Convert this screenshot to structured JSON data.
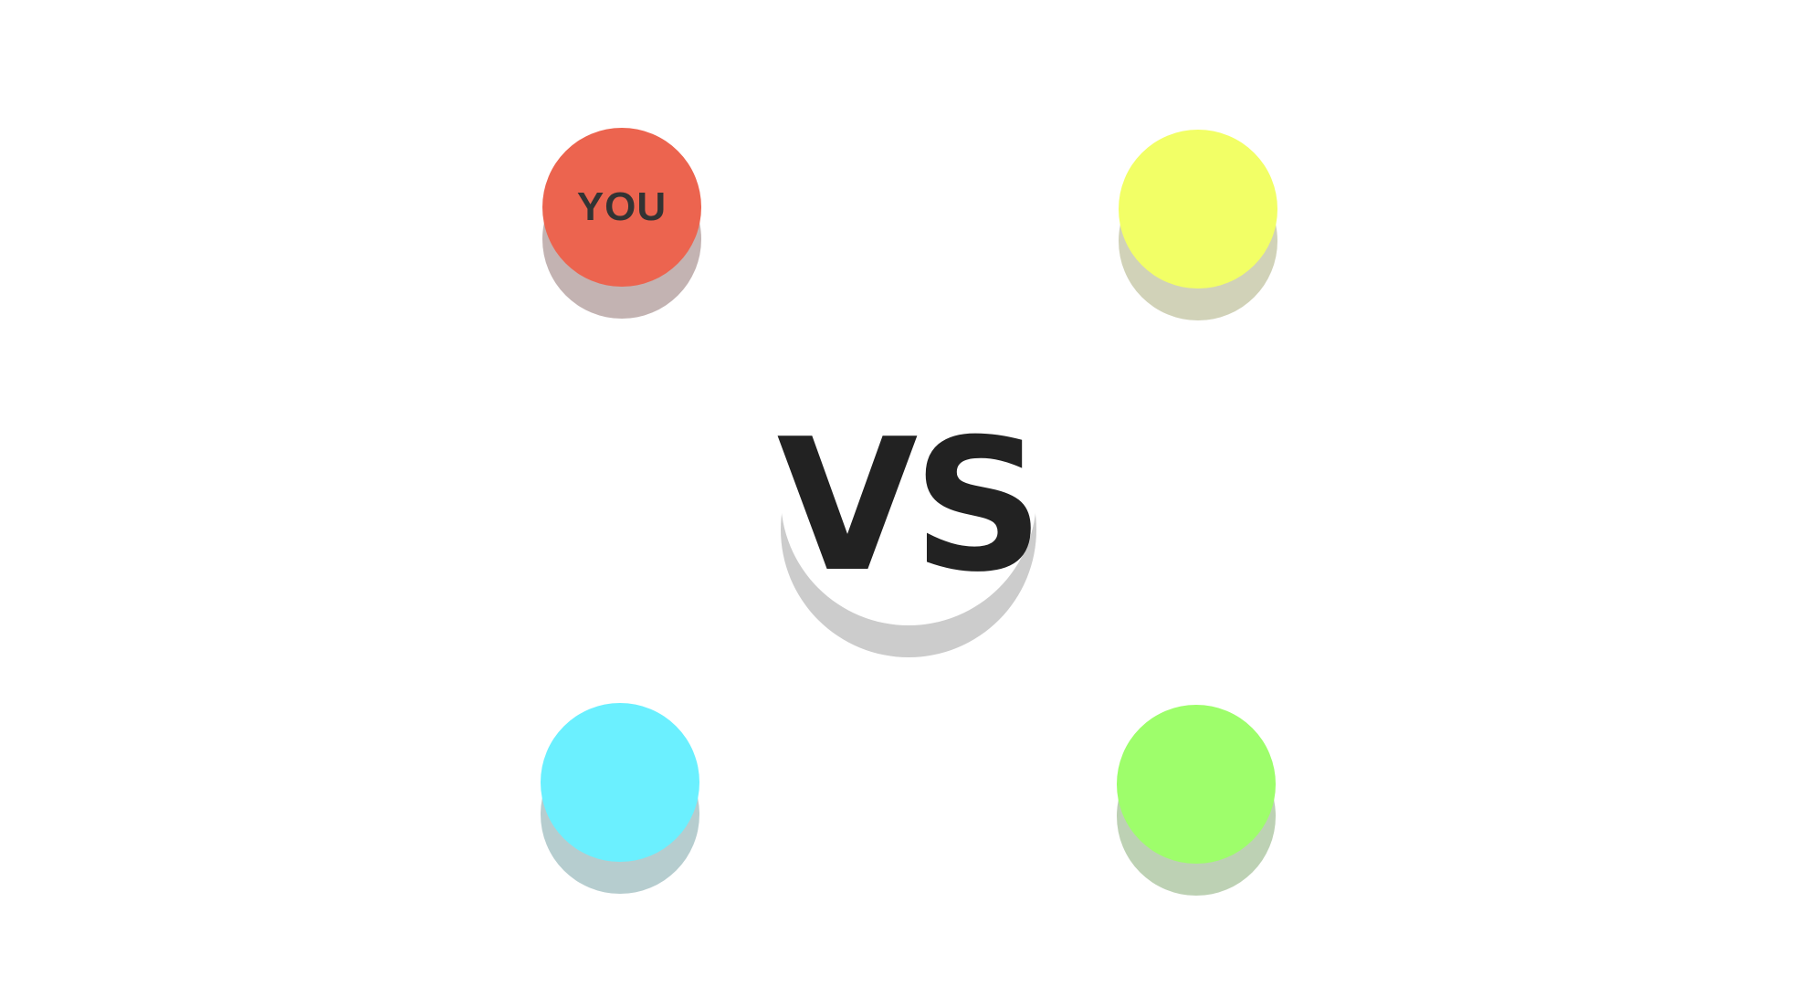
{
  "center": {
    "label": "VS"
  },
  "players": [
    {
      "color": "#ec644f",
      "shadow_color": "#b9a6a5",
      "label": "YOU"
    },
    {
      "color": "#f2ff66",
      "shadow_color": "#c9caab"
    },
    {
      "color": "#6bf0ff",
      "shadow_color": "#a9c4c7"
    },
    {
      "color": "#9efe6b",
      "shadow_color": "#b1c9a7"
    }
  ]
}
